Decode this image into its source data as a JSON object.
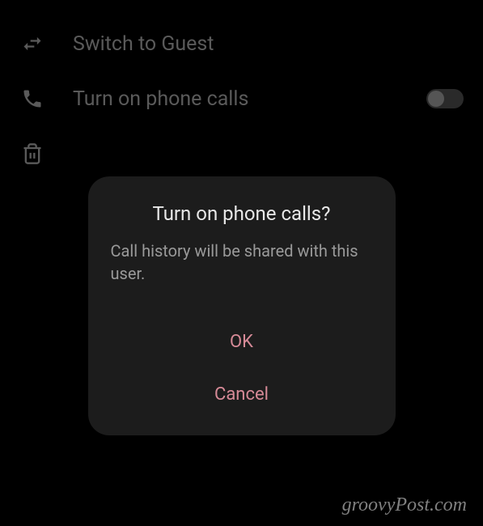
{
  "background": {
    "items": [
      {
        "icon": "swap",
        "label": "Switch to Guest"
      },
      {
        "icon": "phone",
        "label": "Turn on phone calls",
        "toggle": false
      },
      {
        "icon": "trash",
        "label": ""
      }
    ]
  },
  "dialog": {
    "title": "Turn on phone calls?",
    "message": "Call history will be shared with this user.",
    "ok_label": "OK",
    "cancel_label": "Cancel"
  },
  "watermark": "groovyPost.com"
}
